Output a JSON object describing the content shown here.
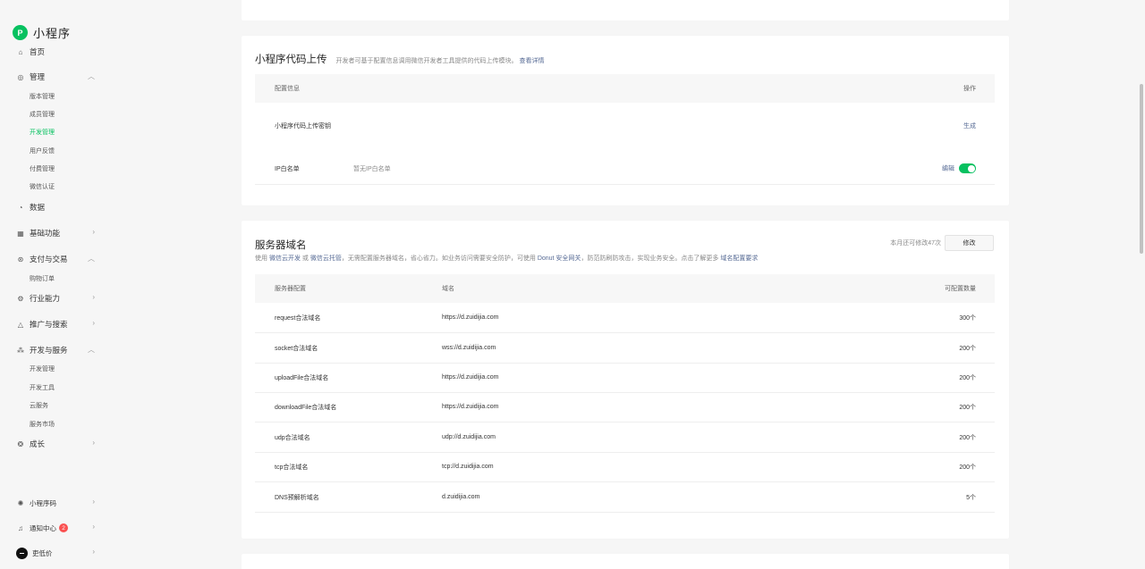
{
  "app": {
    "logo_mark": "P",
    "title": "小程序"
  },
  "nav": {
    "home": "首页",
    "manage": "管理",
    "manage_sub": [
      "版本管理",
      "成员管理",
      "开发管理",
      "用户反馈",
      "付费管理",
      "微信认证"
    ],
    "data": "数据",
    "basic": "基础功能",
    "pay": "支付与交易",
    "pay_sub": [
      "购物订单"
    ],
    "industry": "行业能力",
    "promo": "推广与搜索",
    "dev": "开发与服务",
    "dev_sub": [
      "开发管理",
      "开发工具",
      "云服务",
      "服务市场"
    ],
    "growth": "成长",
    "code": "小程序码",
    "notice": "通知中心",
    "notice_count": "2",
    "user": "吏低价"
  },
  "upload": {
    "title": "小程序代码上传",
    "desc": "开发者可基于配置信息调用微信开发者工具提供的代码上传模块。",
    "desc_link": "查看详情",
    "col_config": "配置信息",
    "col_action": "操作",
    "row1_label": "小程序代码上传密钥",
    "row1_action": "生成",
    "row2_label": "IP白名单",
    "row2_value": "暂无IP白名单",
    "row2_action": "编辑"
  },
  "domain": {
    "title": "服务器域名",
    "quota_text": "本月还可修改47次",
    "modify_btn": "修改",
    "desc_a": "使用",
    "link_a": "微信云开发",
    "desc_b": "或",
    "link_b": "微信云托管",
    "desc_c": "，无需配置服务器域名，省心省力。如业务访问需要安全防护，可使用",
    "link_c": "Donut 安全网关",
    "desc_d": "，防范防刷防攻击，实现业务安全。点击了解更多",
    "link_d": "域名配置要求",
    "col_config": "服务器配置",
    "col_domain": "域名",
    "col_count": "可配置数量",
    "rows": [
      {
        "name": "request合法域名",
        "domain": "https://d.zuidijia.com",
        "count": "300个"
      },
      {
        "name": "socket合法域名",
        "domain": "wss://d.zuidijia.com",
        "count": "200个"
      },
      {
        "name": "uploadFile合法域名",
        "domain": "https://d.zuidijia.com",
        "count": "200个"
      },
      {
        "name": "downloadFile合法域名",
        "domain": "https://d.zuidijia.com",
        "count": "200个"
      },
      {
        "name": "udp合法域名",
        "domain": "udp://d.zuidijia.com",
        "count": "200个"
      },
      {
        "name": "tcp合法域名",
        "domain": "tcp://d.zuidijia.com",
        "count": "200个"
      },
      {
        "name": "DNS预解析域名",
        "domain": "d.zuidijia.com",
        "count": "5个"
      }
    ]
  },
  "colors": {
    "accent": "#07c160",
    "link": "#576b95",
    "badge": "#fa5151"
  }
}
